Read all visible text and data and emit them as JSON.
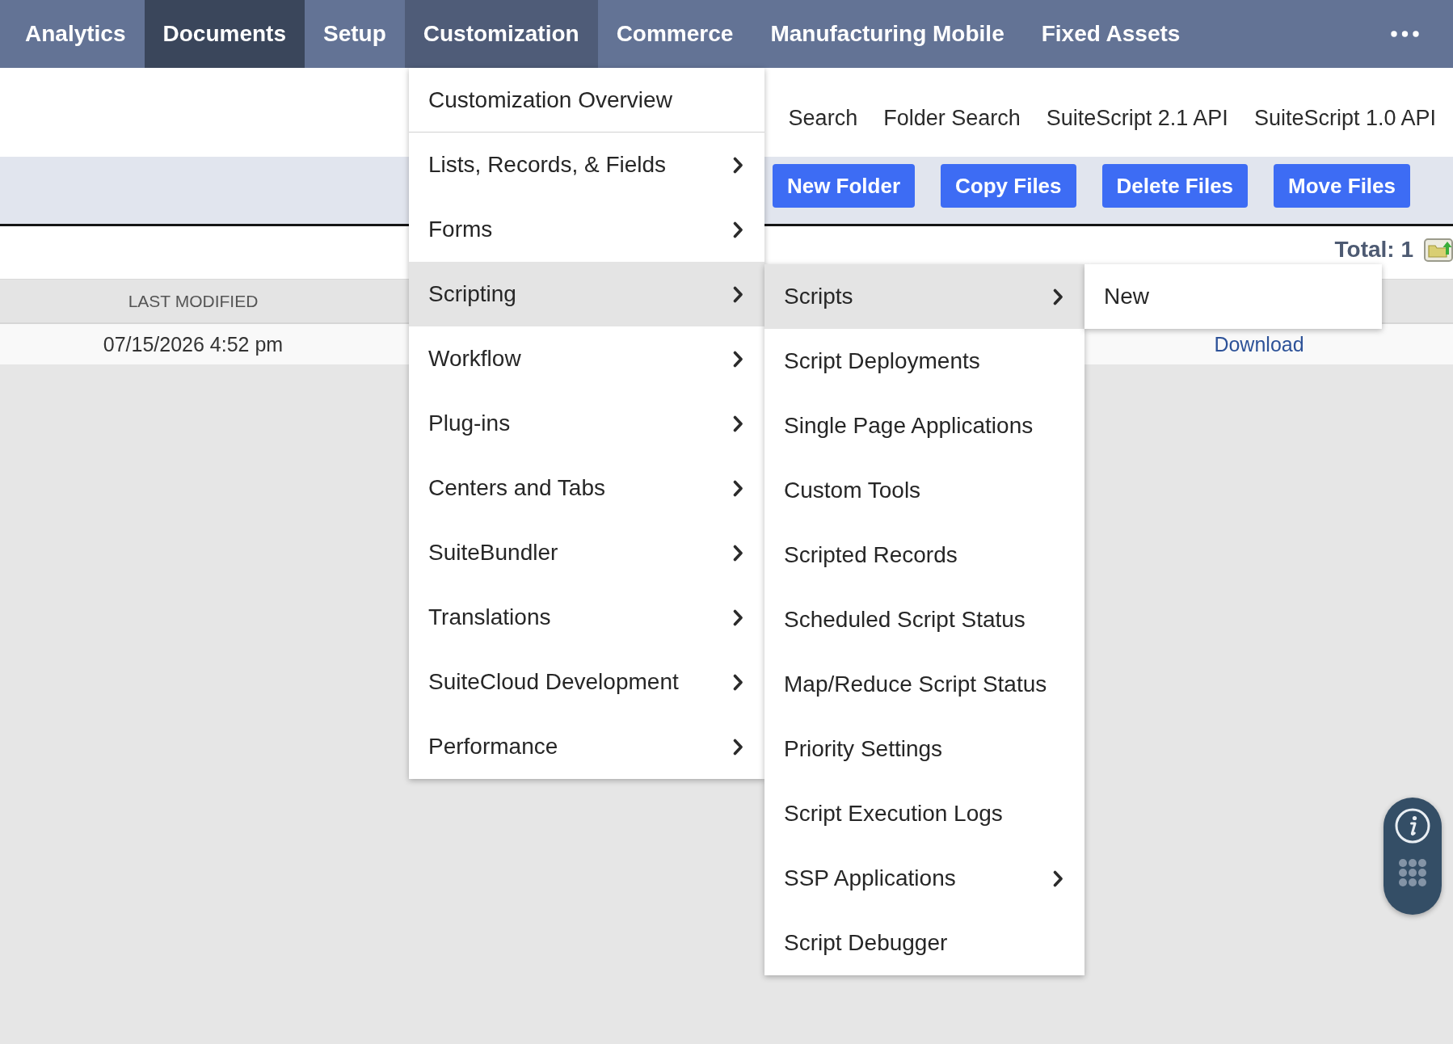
{
  "nav": {
    "tabs": [
      {
        "label": "Analytics",
        "selected": false,
        "expanded": false
      },
      {
        "label": "Documents",
        "selected": true,
        "expanded": false
      },
      {
        "label": "Setup",
        "selected": false,
        "expanded": false
      },
      {
        "label": "Customization",
        "selected": false,
        "expanded": true
      },
      {
        "label": "Commerce",
        "selected": false,
        "expanded": false
      },
      {
        "label": "Manufacturing Mobile",
        "selected": false,
        "expanded": false
      },
      {
        "label": "Fixed Assets",
        "selected": false,
        "expanded": false
      }
    ]
  },
  "menus": [
    {
      "top_item": "Customization Overview",
      "items": [
        {
          "label": "Lists, Records, & Fields",
          "has_submenu": true,
          "selected": false
        },
        {
          "label": "Forms",
          "has_submenu": true,
          "selected": false
        },
        {
          "label": "Scripting",
          "has_submenu": true,
          "selected": true
        },
        {
          "label": "Workflow",
          "has_submenu": true,
          "selected": false
        },
        {
          "label": "Plug-ins",
          "has_submenu": true,
          "selected": false
        },
        {
          "label": "Centers and Tabs",
          "has_submenu": true,
          "selected": false
        },
        {
          "label": "SuiteBundler",
          "has_submenu": true,
          "selected": false
        },
        {
          "label": "Translations",
          "has_submenu": true,
          "selected": false
        },
        {
          "label": "SuiteCloud Development",
          "has_submenu": true,
          "selected": false
        },
        {
          "label": "Performance",
          "has_submenu": true,
          "selected": false
        }
      ]
    },
    {
      "items": [
        {
          "label": "Scripts",
          "has_submenu": true,
          "selected": true
        },
        {
          "label": "Script Deployments",
          "has_submenu": false,
          "selected": false
        },
        {
          "label": "Single Page Applications",
          "has_submenu": false,
          "selected": false
        },
        {
          "label": "Custom Tools",
          "has_submenu": false,
          "selected": false
        },
        {
          "label": "Scripted Records",
          "has_submenu": false,
          "selected": false
        },
        {
          "label": "Scheduled Script Status",
          "has_submenu": false,
          "selected": false
        },
        {
          "label": "Map/Reduce Script Status",
          "has_submenu": false,
          "selected": false
        },
        {
          "label": "Priority Settings",
          "has_submenu": false,
          "selected": false
        },
        {
          "label": "Script Execution Logs",
          "has_submenu": false,
          "selected": false
        },
        {
          "label": "SSP Applications",
          "has_submenu": true,
          "selected": false
        },
        {
          "label": "Script Debugger",
          "has_submenu": false,
          "selected": false
        }
      ]
    },
    {
      "items": [
        {
          "label": "New",
          "has_submenu": false,
          "selected": false
        }
      ]
    }
  ],
  "header_links": [
    "Search",
    "Folder Search",
    "SuiteScript 2.1 API",
    "SuiteScript 1.0 API"
  ],
  "toolbar": {
    "buttons": [
      "New Folder",
      "Copy Files",
      "Delete Files",
      "Move Files"
    ]
  },
  "summary": {
    "total": "Total: 1"
  },
  "table": {
    "columns": [
      "LAST MODIFIED"
    ],
    "rows": [
      {
        "last_modified": "07/15/2026 4:52 pm",
        "action": "Download"
      }
    ]
  }
}
